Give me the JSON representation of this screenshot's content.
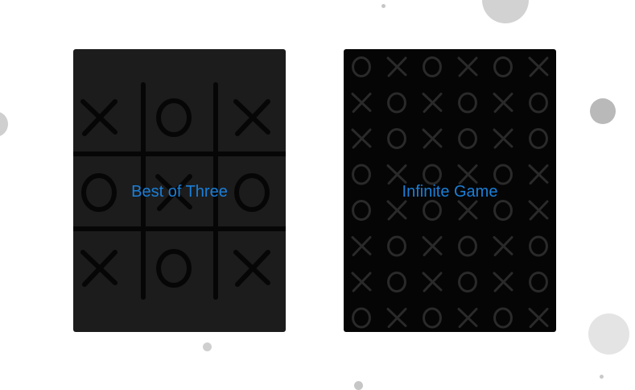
{
  "colors": {
    "background": "#ffffff",
    "card_best_of_three": "#1c1c1c",
    "card_infinite_game": "#050505",
    "label_text": "#1a7fd9",
    "bubble_light": "#d2d2d2",
    "bubble_mid": "#b9b9b9",
    "bubble_pale": "#e4e4e4"
  },
  "modes": [
    {
      "label": "Best of Three",
      "board": [
        "X",
        "O",
        "X",
        "O",
        "X",
        "O",
        "X",
        "O",
        "X"
      ]
    },
    {
      "label": "Infinite Game",
      "pattern_rows": [
        [
          "O",
          "X",
          "O",
          "X",
          "O",
          "X"
        ],
        [
          "X",
          "O",
          "X",
          "O",
          "X",
          "O"
        ],
        [
          "X",
          "O",
          "X",
          "O",
          "X",
          "O"
        ],
        [
          "O",
          "X",
          "O",
          "X",
          "O",
          "X"
        ],
        [
          "O",
          "X",
          "O",
          "X",
          "O",
          "X"
        ],
        [
          "X",
          "O",
          "X",
          "O",
          "X",
          "O"
        ],
        [
          "X",
          "O",
          "X",
          "O",
          "X",
          "O"
        ],
        [
          "O",
          "X",
          "O",
          "X",
          "O",
          "X"
        ]
      ]
    }
  ]
}
